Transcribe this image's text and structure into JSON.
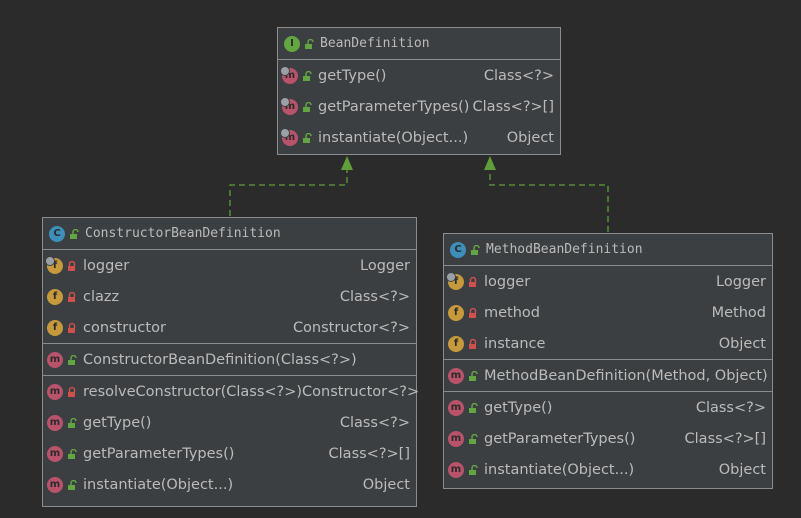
{
  "interface": {
    "icon": "I",
    "name": "BeanDefinition",
    "methods": [
      {
        "name": "getType()",
        "type": "Class<?>",
        "access": "public",
        "icon": "m",
        "abstract": true
      },
      {
        "name": "getParameterTypes()",
        "type": "Class<?>[]",
        "access": "public",
        "icon": "m",
        "abstract": true
      },
      {
        "name": "instantiate(Object...)",
        "type": "Object",
        "access": "public",
        "icon": "m",
        "abstract": true
      }
    ]
  },
  "constructor_class": {
    "icon": "C",
    "name": "ConstructorBeanDefinition",
    "fields": [
      {
        "name": "logger",
        "type": "Logger",
        "access": "private",
        "icon": "f"
      },
      {
        "name": "clazz",
        "type": "Class<?>",
        "access": "private",
        "icon": "f"
      },
      {
        "name": "constructor",
        "type": "Constructor<?>",
        "access": "private",
        "icon": "f"
      }
    ],
    "constructors": [
      {
        "name": "ConstructorBeanDefinition(Class<?>)",
        "type": "",
        "access": "public",
        "icon": "m"
      }
    ],
    "methods": [
      {
        "name": "resolveConstructor(Class<?>)",
        "type": "Constructor<?>",
        "access": "private",
        "icon": "m"
      },
      {
        "name": "getType()",
        "type": "Class<?>",
        "access": "public",
        "icon": "m"
      },
      {
        "name": "getParameterTypes()",
        "type": "Class<?>[]",
        "access": "public",
        "icon": "m"
      },
      {
        "name": "instantiate(Object...)",
        "type": "Object",
        "access": "public",
        "icon": "m"
      }
    ]
  },
  "method_class": {
    "icon": "C",
    "name": "MethodBeanDefinition",
    "fields": [
      {
        "name": "logger",
        "type": "Logger",
        "access": "private",
        "icon": "f"
      },
      {
        "name": "method",
        "type": "Method",
        "access": "private",
        "icon": "f"
      },
      {
        "name": "instance",
        "type": "Object",
        "access": "private",
        "icon": "f"
      }
    ],
    "constructors": [
      {
        "name": "MethodBeanDefinition(Method, Object)",
        "type": "",
        "access": "public",
        "icon": "m"
      }
    ],
    "methods": [
      {
        "name": "getType()",
        "type": "Class<?>",
        "access": "public",
        "icon": "m"
      },
      {
        "name": "getParameterTypes()",
        "type": "Class<?>[]",
        "access": "public",
        "icon": "m"
      },
      {
        "name": "instantiate(Object...)",
        "type": "Object",
        "access": "public",
        "icon": "m"
      }
    ]
  },
  "colors": {
    "background": "#2b2b2b",
    "box": "#3c3f41",
    "border": "#8c8c8c",
    "arrow": "#5f9e3a",
    "public_lock": "#62a642",
    "private_lock": "#d0504b"
  }
}
